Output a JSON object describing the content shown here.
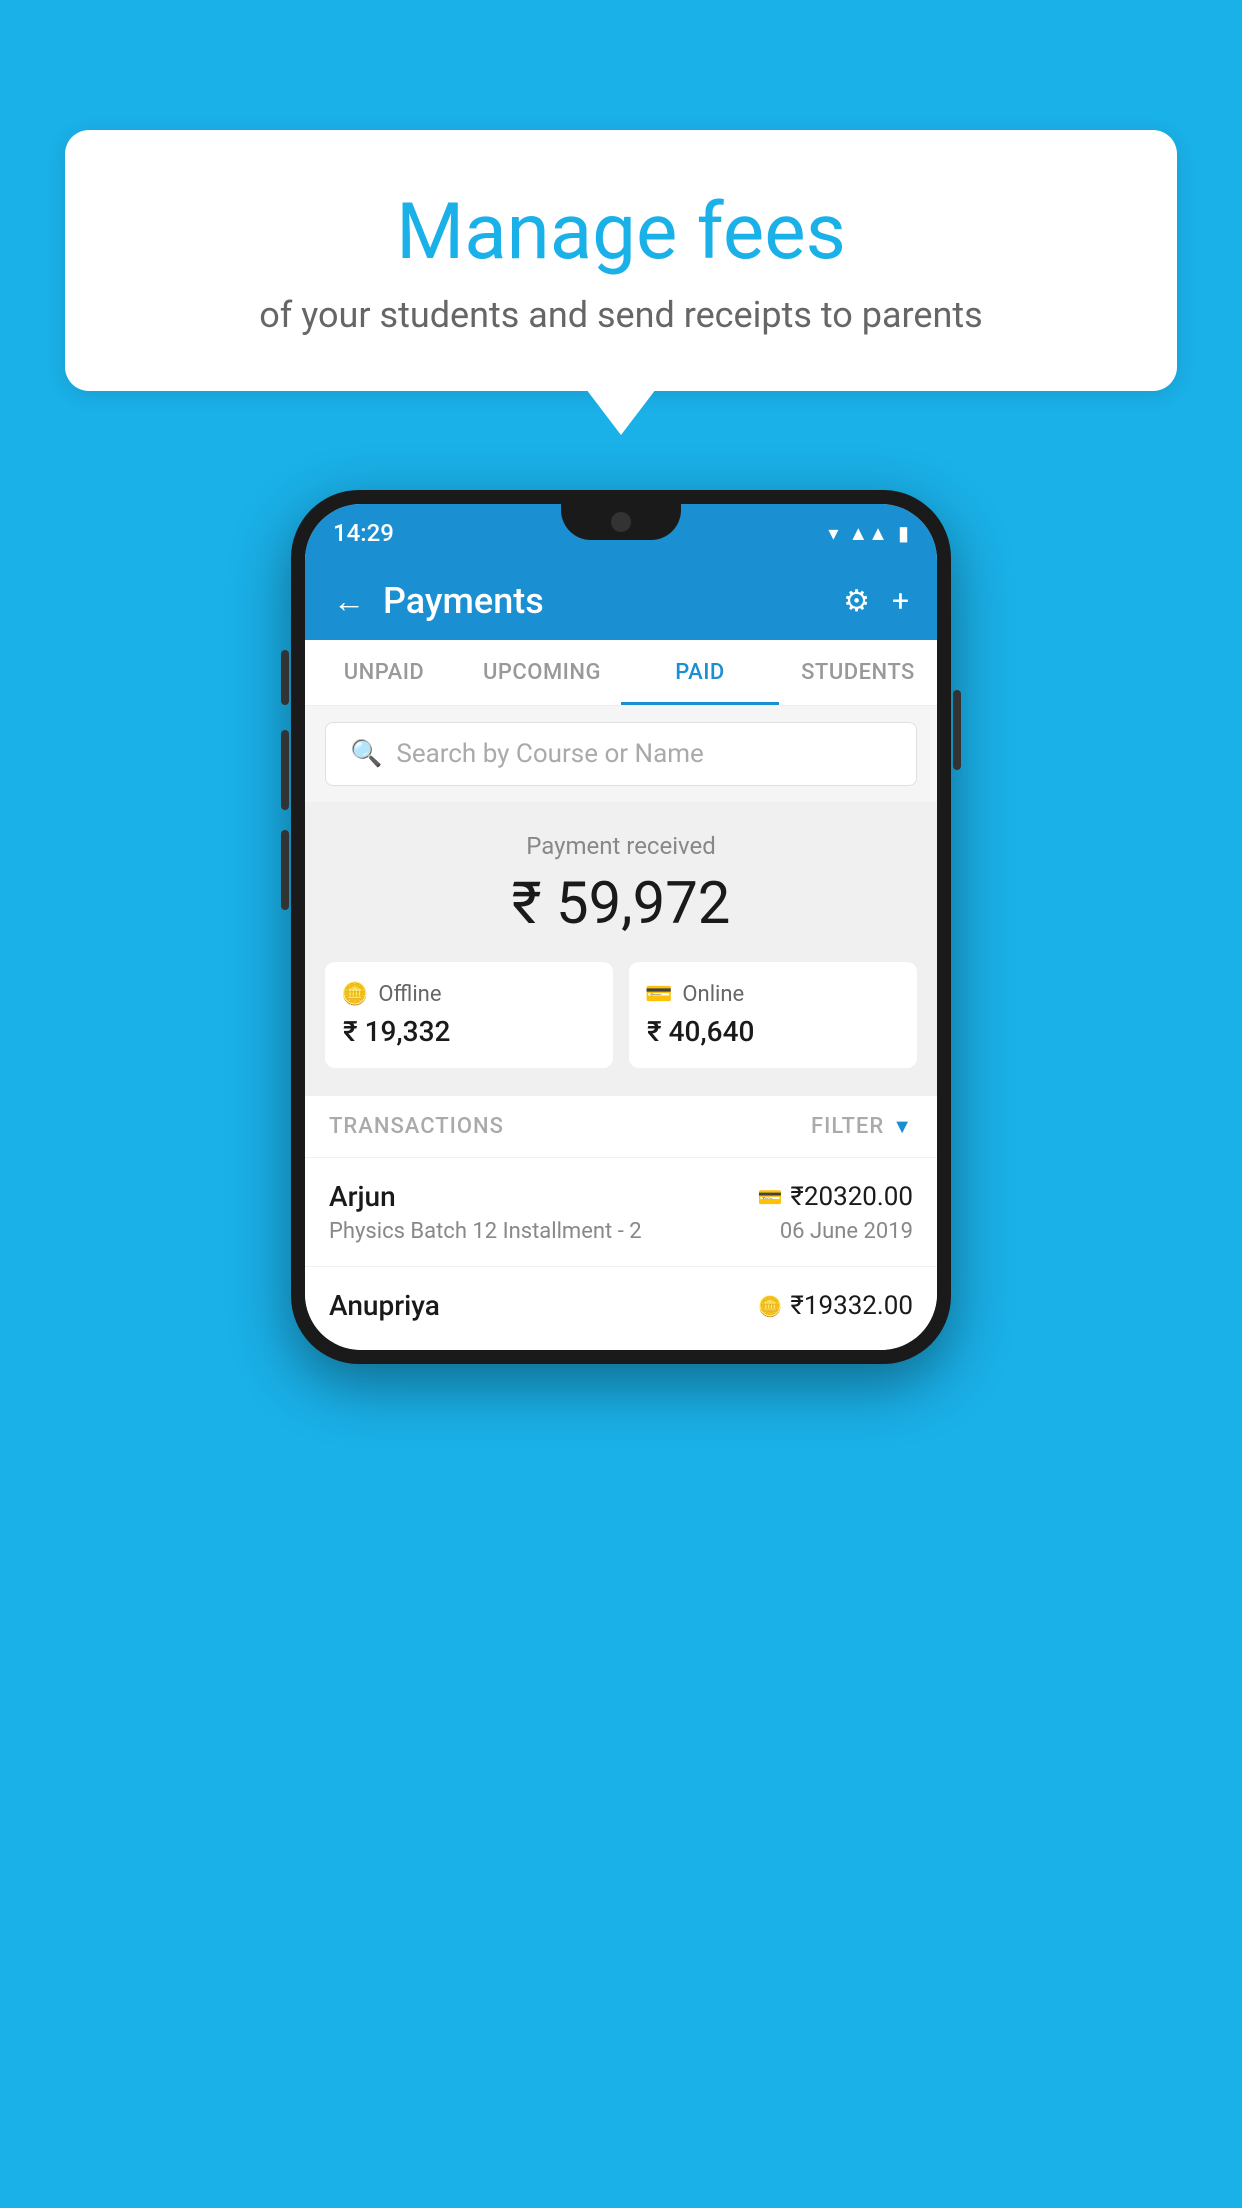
{
  "bubble": {
    "title": "Manage fees",
    "subtitle": "of your students and send receipts to parents"
  },
  "phone": {
    "status_bar": {
      "time": "14:29"
    },
    "header": {
      "title": "Payments",
      "back_label": "←",
      "settings_label": "⚙",
      "add_label": "+"
    },
    "tabs": [
      {
        "label": "UNPAID",
        "active": false
      },
      {
        "label": "UPCOMING",
        "active": false
      },
      {
        "label": "PAID",
        "active": true
      },
      {
        "label": "STUDENTS",
        "active": false
      }
    ],
    "search": {
      "placeholder": "Search by Course or Name"
    },
    "payment_summary": {
      "label": "Payment received",
      "total": "₹ 59,972",
      "offline": {
        "icon": "💳",
        "label": "Offline",
        "amount": "₹ 19,332"
      },
      "online": {
        "icon": "💳",
        "label": "Online",
        "amount": "₹ 40,640"
      }
    },
    "transactions": {
      "label": "TRANSACTIONS",
      "filter_label": "FILTER",
      "rows": [
        {
          "name": "Arjun",
          "course": "Physics Batch 12 Installment - 2",
          "amount": "₹20320.00",
          "date": "06 June 2019",
          "payment_type": "card"
        },
        {
          "name": "Anupriya",
          "course": "",
          "amount": "₹19332.00",
          "date": "",
          "payment_type": "cash"
        }
      ]
    }
  }
}
